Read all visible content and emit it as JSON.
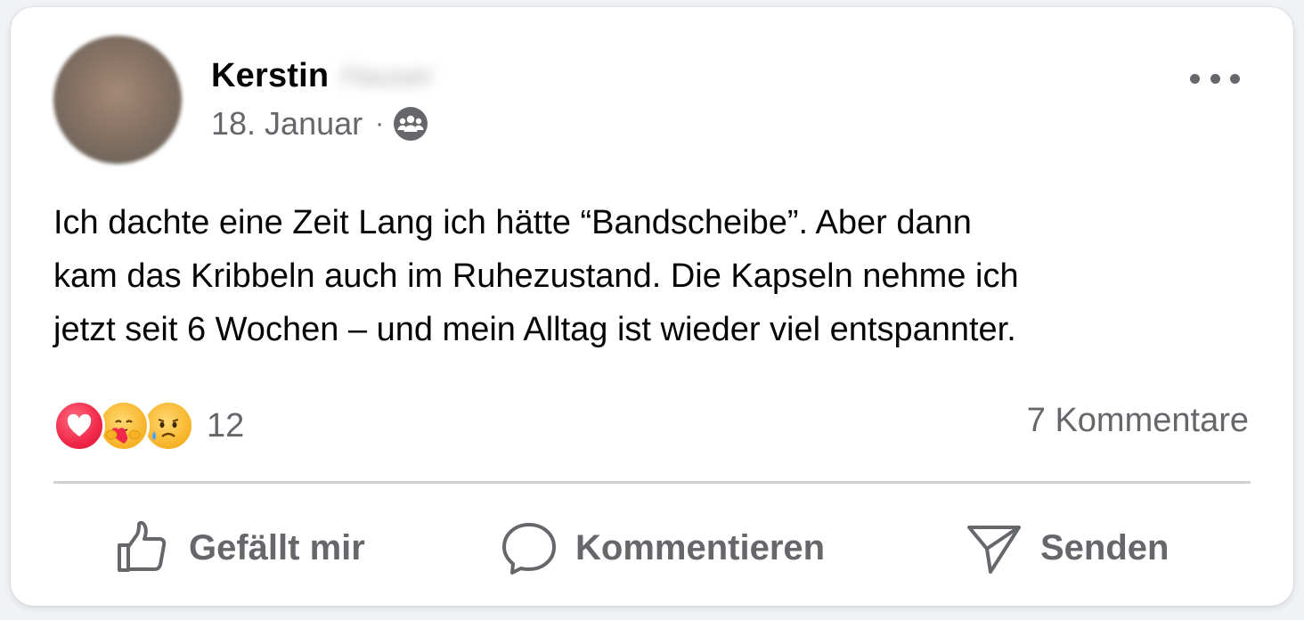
{
  "post": {
    "author_first_name": "Kerstin",
    "author_last_name_redacted": "Hauser",
    "date": "18. Januar",
    "meta_separator": "·",
    "audience_icon": "group-icon",
    "text_lines": [
      "Ich dachte eine Zeit Lang ich hätte “Bandscheibe”. Aber dann",
      "kam das Kribbeln auch im Ruhezustand. Die Kapseln nehme ich",
      "jetzt seit 6 Wochen – und mein Alltag ist wieder viel entspannter."
    ]
  },
  "engagement": {
    "reaction_icons": [
      "love-reaction-icon",
      "care-reaction-icon",
      "sad-reaction-icon"
    ],
    "reaction_count": "12",
    "comments_label": "7 Kommentare"
  },
  "actions": {
    "like_label": "Gefällt mir",
    "comment_label": "Kommentieren",
    "send_label": "Senden"
  },
  "colors": {
    "primary_text": "#050505",
    "secondary_text": "#65676b",
    "divider": "#ced0d4",
    "love": "#f02849",
    "care_sad": "#f7b125"
  }
}
